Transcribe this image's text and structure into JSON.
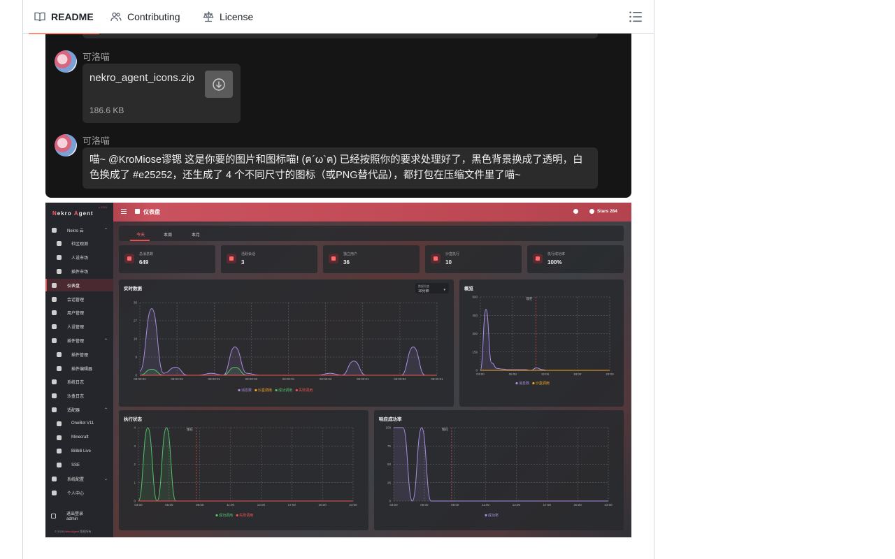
{
  "tabs": [
    {
      "label": "README",
      "icon": "book-icon",
      "active": true
    },
    {
      "label": "Contributing",
      "icon": "people-icon",
      "active": false
    },
    {
      "label": "License",
      "icon": "law-icon",
      "active": false
    }
  ],
  "chat": {
    "messages": [
      {
        "sender": "可洛喵",
        "type": "file",
        "file_name": "nekro_agent_icons.zip",
        "file_size": "186.6 KB"
      },
      {
        "sender": "可洛喵",
        "type": "text",
        "text": "喵~ @KroMiose谬锶 这是你要的图片和图标喵! (ฅ´ω`ฅ) 已经按照你的要求处理好了，黑色背景换成了透明，白色换成了 #e25252，还生成了 4 个不同尺寸的图标（或PNG替代品），都打包在压缩文件里了喵~"
      }
    ]
  },
  "dashboard": {
    "brand_first": "N",
    "brand_mid": "ekro ",
    "brand_second": "A",
    "brand_rest": "gent",
    "version": "v 1.5.0",
    "page_title": "仪表盘",
    "stars": "Stars 284",
    "sidebar": [
      {
        "label": "Nekro 云",
        "level": 0,
        "chevron": "^"
      },
      {
        "label": "社区观测",
        "level": 1
      },
      {
        "label": "人设市场",
        "level": 1
      },
      {
        "label": "插件市场",
        "level": 1
      },
      {
        "label": "仪表盘",
        "level": 0,
        "active": true
      },
      {
        "label": "会话管理",
        "level": 0
      },
      {
        "label": "用户管理",
        "level": 0
      },
      {
        "label": "人设管理",
        "level": 0
      },
      {
        "label": "插件管理",
        "level": 0,
        "chevron": "^"
      },
      {
        "label": "插件管理",
        "level": 1
      },
      {
        "label": "插件编辑器",
        "level": 1
      },
      {
        "label": "系统日志",
        "level": 0
      },
      {
        "label": "沙盒日志",
        "level": 0
      },
      {
        "label": "适配器",
        "level": 0,
        "chevron": "^"
      },
      {
        "label": "OneBot V11",
        "level": 1
      },
      {
        "label": "Minecraft",
        "level": 1
      },
      {
        "label": "Bilibili Live",
        "level": 1
      },
      {
        "label": "SSE",
        "level": 1
      },
      {
        "label": "系统配置",
        "level": 0,
        "chevron": "v"
      },
      {
        "label": "个人中心",
        "level": 0
      }
    ],
    "logout_label": "退出登录",
    "logout_user": "admin",
    "footer_prefix": "© 2025 ",
    "footer_brand": "NekroAgent",
    "footer_suffix": " 版权所有",
    "range_tabs": [
      "今天",
      "本周",
      "本月"
    ],
    "stats": [
      {
        "label": "总消息数",
        "value": "649"
      },
      {
        "label": "活跃会话",
        "value": "3"
      },
      {
        "label": "独立用户",
        "value": "36"
      },
      {
        "label": "沙盒执行",
        "value": "10"
      },
      {
        "label": "执行成功率",
        "value": "100%"
      }
    ],
    "realtime": {
      "title": "实时数据",
      "select_label": "数据粒度",
      "select_value": "10分钟",
      "legend": [
        "消息数",
        "沙盒调用",
        "成功调用",
        "失败调用"
      ]
    },
    "overview": {
      "title": "概览",
      "now_label": "现在",
      "legend": [
        "消息数",
        "沙盒调用"
      ]
    },
    "exec": {
      "title": "执行状态",
      "now_label": "现在",
      "legend": [
        "成功调用",
        "失败调用"
      ]
    },
    "response": {
      "title": "响应成功率",
      "now_label": "现在",
      "legend": [
        "成功率"
      ]
    }
  },
  "chart_data": [
    {
      "type": "line",
      "title": "实时数据",
      "x": [
        "08:00:02",
        "08:00:02",
        "08:00:01",
        "08:00:02",
        "08:00:01",
        "08:00:02",
        "08:00:01",
        "08:00:02",
        "08:00:01"
      ],
      "y_ticks": [
        0,
        9,
        18,
        27,
        36
      ],
      "ylim": [
        0,
        36
      ],
      "series": [
        {
          "name": "消息数",
          "color": "#a98ee0",
          "values": [
            2,
            33,
            1,
            4,
            0,
            0,
            1,
            0,
            14,
            1,
            0,
            0,
            0,
            0,
            0,
            0,
            1,
            0,
            7,
            0,
            0,
            0,
            0,
            14,
            0,
            0
          ]
        },
        {
          "name": "沙盒调用",
          "color": "#f5a623",
          "values": [
            0,
            0,
            0,
            0,
            0,
            0,
            0,
            0,
            0,
            0,
            0,
            0,
            0,
            0,
            0,
            0,
            0,
            0,
            0,
            0,
            0,
            0,
            0,
            0,
            0,
            0
          ]
        },
        {
          "name": "成功调用",
          "color": "#55c46b",
          "values": [
            0,
            3,
            0,
            0,
            0,
            0,
            0,
            0,
            4,
            0,
            0,
            0,
            0,
            0,
            0,
            0,
            0,
            0,
            0,
            0,
            0,
            0,
            0,
            0,
            0,
            0
          ]
        },
        {
          "name": "失败调用",
          "color": "#ef5350",
          "values": [
            0,
            0,
            0,
            0,
            0,
            0,
            0,
            0,
            0,
            0,
            0,
            0,
            0,
            0,
            0,
            0,
            0,
            0,
            0,
            0,
            0,
            0,
            0,
            0,
            0,
            0
          ]
        }
      ]
    },
    {
      "type": "line",
      "title": "概览",
      "x": [
        "03:00",
        "06:00",
        "12:00",
        "18:00",
        "23:00"
      ],
      "y_ticks": [
        0,
        150,
        300,
        450,
        600
      ],
      "ylim": [
        0,
        600
      ],
      "series": [
        {
          "name": "消息数",
          "color": "#a98ee0",
          "values": [
            0,
            500,
            60,
            15,
            10,
            5,
            5,
            5,
            5,
            0,
            20,
            5,
            0,
            0,
            0,
            0,
            0,
            0,
            0,
            0,
            0,
            0,
            0,
            0
          ]
        },
        {
          "name": "沙盒调用",
          "color": "#f5a623",
          "values": [
            0,
            0,
            0,
            0,
            0,
            0,
            0,
            0,
            0,
            0,
            0,
            0,
            0,
            0,
            0,
            0,
            0,
            0,
            0,
            0,
            0,
            0,
            0,
            0
          ]
        }
      ]
    },
    {
      "type": "line",
      "title": "执行状态",
      "x": [
        "03:00",
        "06:00",
        "08:00",
        "11:00",
        "14:00",
        "17:00",
        "20:00",
        "23:00"
      ],
      "y_ticks": [
        0,
        1,
        2,
        3,
        4
      ],
      "ylim": [
        0,
        4
      ],
      "series": [
        {
          "name": "成功调用",
          "color": "#55c46b",
          "values": [
            0,
            4,
            0,
            4,
            0,
            0,
            0,
            0,
            0,
            0,
            0,
            0,
            0,
            0,
            0,
            0,
            0,
            0,
            0,
            0,
            0,
            0,
            0,
            0
          ]
        },
        {
          "name": "失败调用",
          "color": "#ef5350",
          "values": [
            0,
            0,
            0,
            0,
            0,
            0,
            0,
            0,
            0,
            0,
            0,
            0,
            0,
            0,
            0,
            0,
            0,
            0,
            0,
            0,
            0,
            0,
            0,
            0
          ]
        }
      ]
    },
    {
      "type": "line",
      "title": "响应成功率",
      "x": [
        "03:00",
        "06:00",
        "08:00",
        "11:00",
        "14:00",
        "17:00",
        "20:00",
        "23:00"
      ],
      "y_ticks": [
        0,
        25,
        50,
        75,
        100
      ],
      "ylim": [
        0,
        100
      ],
      "series": [
        {
          "name": "成功率",
          "color": "#a98ee0",
          "values": [
            100,
            100,
            0,
            100,
            0,
            0,
            0,
            0,
            0,
            0,
            0,
            0,
            0,
            0,
            0,
            0,
            0,
            0,
            0,
            0,
            0,
            0,
            0,
            0
          ]
        }
      ]
    }
  ]
}
